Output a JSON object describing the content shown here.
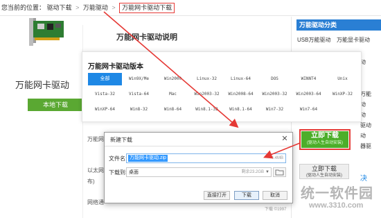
{
  "breadcrumb": {
    "prefix": "您当前的位置：",
    "items": [
      "驱动下载",
      "万能驱动",
      "万能网卡驱动下载"
    ]
  },
  "product": {
    "name": "万能网卡驱动",
    "local_download_label": "本地下载"
  },
  "page_title": "万能网卡驱动说明",
  "sidebar": {
    "heading": "万能驱动分类",
    "items": [
      "USB万能驱动",
      "万能显卡驱动"
    ],
    "fragments": [
      "动",
      "万能",
      "动",
      "动",
      "驱动",
      "动",
      "盘驱",
      "动",
      "器驱",
      "动",
      "决"
    ]
  },
  "version_panel": {
    "title": "万能网卡驱动版本",
    "versions": [
      [
        "全部",
        "Win9X/Me",
        "Win2000",
        "Linux-32",
        "Linux-64",
        "DOS",
        "WINNT4",
        "Unix"
      ],
      [
        "Vista-32",
        "Vista-64",
        "Mac",
        "Win2003-32",
        "Win2008-64",
        "Win2003-32",
        "Win2003-64",
        "WinXP-32"
      ],
      [
        "WinXP-64",
        "Win8-32",
        "Win8-64",
        "Win8.1-32",
        "Win8.1-64",
        "Win7-32",
        "Win7-64",
        ""
      ]
    ]
  },
  "download_buttons": {
    "primary_label": "立即下载",
    "primary_sub": "(驱动人生自动安装)",
    "secondary_label": "立即下载",
    "secondary_sub": "(驱动人生自动安装)"
  },
  "dialog": {
    "title": "新建下载",
    "filename_label": "文件名:",
    "filename_value": "万能网卡驱动.zip",
    "file_size": "4.4MB",
    "saveto_label": "下载到:",
    "saveto_value": "桌面",
    "free_space": "剩余23.2GB",
    "open_button": "直接打开",
    "download_button": "下载",
    "cancel_button": "取消"
  },
  "left_fragments": [
    "万能网",
    "以太网",
    "布)",
    "网络通"
  ],
  "behind_text": "下载  ©1997",
  "watermark": {
    "text": "统一软件园",
    "url": "www.3310.com"
  },
  "colors": {
    "accent_blue": "#1e88e5",
    "download_green": "#4cae2a",
    "highlight_red": "#e53935"
  },
  "icons": [
    "network-card-image",
    "close-icon",
    "chevron-down-icon",
    "folder-icon",
    "arrow-annotation"
  ]
}
